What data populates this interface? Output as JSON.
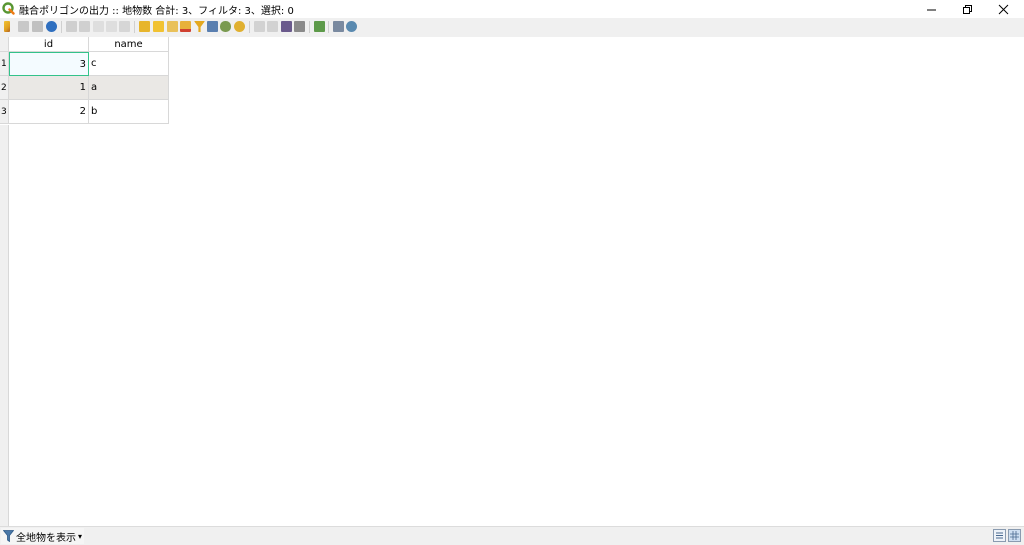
{
  "window": {
    "title": "融合ポリゴンの出力 :: 地物数 合計: 3、フィルタ: 3、選択: 0",
    "minimize_glyph": "─",
    "maximize_glyph": "❐",
    "close_glyph": "✕"
  },
  "app_icon": "qgis-logo-icon",
  "toolbar": {
    "icons": [
      "edit-pencil-icon",
      "multi-edit-icon",
      "save-edits-icon",
      "reload-icon",
      "add-feature-icon",
      "delete-feature-icon",
      "cut-icon",
      "copy-icon",
      "paste-icon",
      "select-by-expression-icon",
      "select-all-icon",
      "invert-selection-icon",
      "deselect-all-icon",
      "filter-icon",
      "move-selection-to-top-icon",
      "pan-to-selection-icon",
      "zoom-to-selection-icon",
      "new-field-icon",
      "delete-field-icon",
      "field-calculator-icon",
      "conditional-formatting-icon",
      "actions-icon",
      "dock-icon",
      "zoom-map-icon"
    ]
  },
  "table": {
    "columns": [
      "id",
      "name"
    ],
    "rows": [
      {
        "header": "1",
        "id": "3",
        "name": "c"
      },
      {
        "header": "2",
        "id": "1",
        "name": "a"
      },
      {
        "header": "3",
        "id": "2",
        "name": "b"
      }
    ]
  },
  "bottombar": {
    "filter_label": "全地物を表示",
    "dropdown_glyph": "▾"
  },
  "colors": {
    "focus_border": "#33c28a",
    "alt_row": "#eae8e5",
    "qgis_green": "#589632"
  }
}
